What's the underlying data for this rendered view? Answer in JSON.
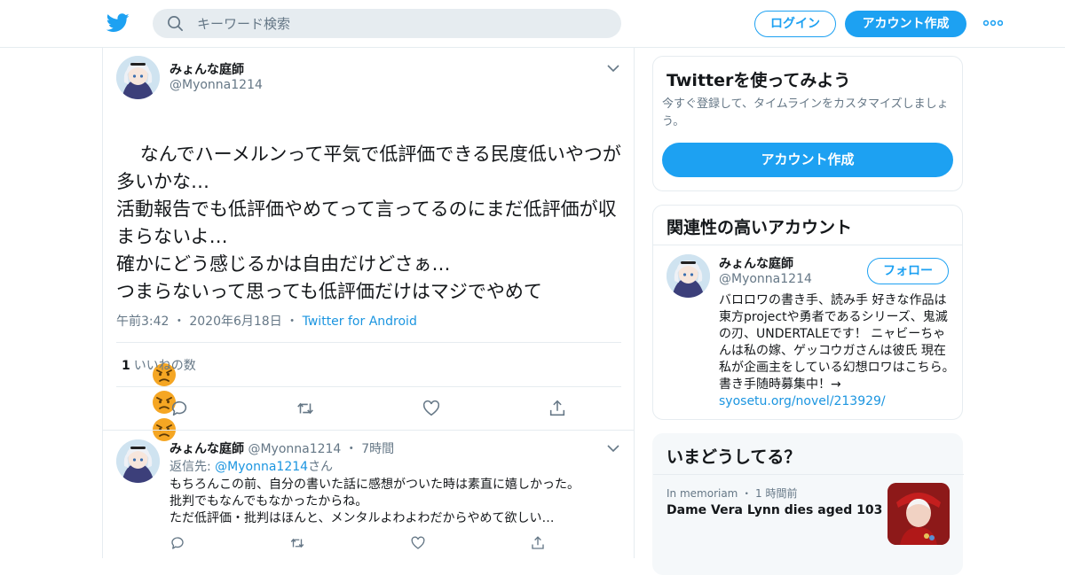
{
  "colors": {
    "brand": "#1da1f2",
    "link": "#1b95e0",
    "secondary_text": "#657786",
    "border": "#e6ecf0"
  },
  "topbar": {
    "logo_icon": "twitter-bird-icon",
    "search_placeholder": "キーワード検索",
    "login_label": "ログイン",
    "signup_label": "アカウント作成",
    "more_icon": "more-dots-icon"
  },
  "tweet": {
    "author_name": "みょんな庭師",
    "author_handle": "@Myonna1214",
    "text": "なんでハーメルンって平気で低評価できる民度低いやつが多いかな…\n活動報告でも低評価やめてって言ってるのにまだ低評価が収まらないよ…\n確かにどう感じるかは自由だけどさぁ…\nつまらないって思っても低評価だけはマジでやめて",
    "emojis": [
      "angry-face-icon",
      "angry-face-icon",
      "angry-face-icon"
    ],
    "time": "午前3:42",
    "date": "2020年6月18日",
    "source": "Twitter for Android",
    "like_count": "1",
    "like_label": "いいねの数",
    "actions": [
      "reply-icon",
      "retweet-icon",
      "like-icon",
      "share-icon"
    ]
  },
  "reply": {
    "author_name": "みょんな庭師",
    "author_handle": "@Myonna1214",
    "age": "7時間",
    "reply_to_prefix": "返信先:",
    "reply_to_handle": "@Myonna1214",
    "reply_to_suffix": "さん",
    "text": "もちろんこの前、自分の書いた話に感想がついた時は素直に嬉しかった。\n批判でもなんでもなかったからね。\nただ低評価・批判はほんと、メンタルよわよわだからやめて欲しい…"
  },
  "sidebar": {
    "promo": {
      "title": "Twitterを使ってみよう",
      "description": "今すぐ登録して、タイムラインをカスタマイズしましょう。",
      "button_label": "アカウント作成"
    },
    "related": {
      "title": "関連性の高いアカウント",
      "name": "みょんな庭師",
      "handle": "@Myonna1214",
      "follow_label": "フォロー",
      "bio": "バロロワの書き手、読み手 好きな作品は東方projectや勇者であるシリーズ、鬼滅の刃、UNDERTALEです！ ニャビーちゃんは私の嫁、ゲッコウガさんは彼氏 現在私が企画主をしている幻想ロワはこちら。書き手随時募集中！→ ",
      "bio_link": "syosetu.org/novel/213929/"
    },
    "trends": {
      "title": "いまどうしてる？",
      "category": "In memoriam",
      "age": "1 時間前",
      "headline": "Dame Vera Lynn dies aged 103"
    }
  }
}
